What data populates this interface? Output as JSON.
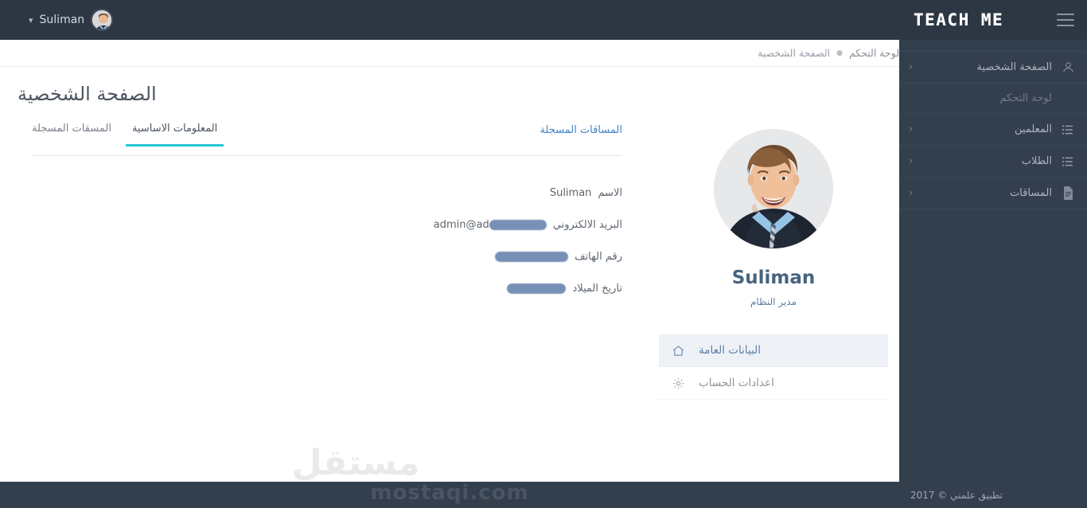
{
  "brand": {
    "logo_text": "TEACH ME"
  },
  "topbar": {
    "user_name": "Suliman",
    "caret": "⌄"
  },
  "sidebar": {
    "items": [
      {
        "label": "الصفحة الشخصية",
        "icon": "user-icon",
        "chevron": "‹",
        "type": "item"
      },
      {
        "label": "لوحة التحكم",
        "icon": "",
        "chevron": "",
        "type": "sub"
      },
      {
        "label": "المعلمين",
        "icon": "list-icon",
        "chevron": "‹",
        "type": "item"
      },
      {
        "label": "الطلاب",
        "icon": "list-icon",
        "chevron": "‹",
        "type": "item"
      },
      {
        "label": "المساقات",
        "icon": "file-icon",
        "chevron": "‹",
        "type": "item"
      }
    ],
    "footer_text": "تطبيق علمني © 2017"
  },
  "breadcrumb": {
    "items": [
      {
        "label": "لوحة التحكم"
      },
      {
        "label": "الصفحة الشخصية"
      }
    ],
    "separator": "●"
  },
  "page": {
    "title": "الصفحة الشخصية"
  },
  "profile": {
    "name": "Suliman",
    "role": "مدير النظام",
    "menu": [
      {
        "label": "البيانات العامة",
        "icon": "home-icon",
        "active": true
      },
      {
        "label": "اعدادات الحساب",
        "icon": "gear-icon",
        "active": false
      }
    ]
  },
  "tabs": {
    "right_link": "المساقات المسجلة",
    "items": [
      {
        "label": "المعلومات الاساسية",
        "active": true
      },
      {
        "label": "المسقات المسجلة",
        "active": false
      }
    ]
  },
  "basic_info": {
    "rows": [
      {
        "label": "الاسم",
        "value": "Suliman",
        "redacted": false
      },
      {
        "label": "البريد الالكتروني",
        "value": "admin@ad",
        "redacted": true
      },
      {
        "label": "رقم الهاتف",
        "value": "",
        "redacted": true
      },
      {
        "label": "تاريخ الميلاد",
        "value": "",
        "redacted": true
      }
    ]
  },
  "watermark": {
    "logo": "مستقل",
    "url": "mostaqi.com"
  },
  "colors": {
    "sidebar_bg": "#343f4e",
    "topbar_bg": "#2d3744",
    "accent_teal": "#29c6d8",
    "link_blue": "#3f83c6",
    "profile_name": "#46647f",
    "active_item_bg": "#eef2f7"
  }
}
